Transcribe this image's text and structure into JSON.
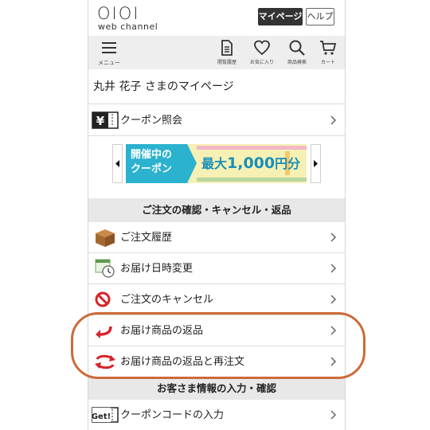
{
  "header": {
    "logo": "OIOI",
    "logo_sub": "web channel",
    "mypage_label": "マイページ",
    "help_label": "ヘルプ"
  },
  "iconbar": {
    "menu_label": "メニュー",
    "tools": [
      {
        "label": "閲覧履歴",
        "icon": "history-icon"
      },
      {
        "label": "お気に入り",
        "icon": "heart-icon"
      },
      {
        "label": "商品検索",
        "icon": "search-icon"
      },
      {
        "label": "カート",
        "icon": "cart-icon"
      }
    ]
  },
  "page": {
    "title": "丸井 花子 さまのマイページ"
  },
  "coupon_row": {
    "label": "クーポン照会",
    "icon_text": "¥"
  },
  "banner": {
    "tag_line1": "開催中の",
    "tag_line2": "クーポン",
    "main_prefix": "最大",
    "main_amount": "1,000",
    "main_suffix": "円分",
    "colors": {
      "teal": "#2ab2cf",
      "yellow": "#f6f0b4"
    }
  },
  "sections": {
    "orders": {
      "title": "ご注文の確認・キャンセル・返品",
      "items": [
        {
          "label": "ご注文履歴",
          "icon": "box-icon"
        },
        {
          "label": "お届け日時変更",
          "icon": "calendar-clock-icon"
        },
        {
          "label": "ご注文のキャンセル",
          "icon": "cancel-icon"
        },
        {
          "label": "お届け商品の返品",
          "icon": "return-arrow-icon"
        },
        {
          "label": "お届け商品の返品と再注文",
          "icon": "reorder-arrows-icon"
        }
      ]
    },
    "customer": {
      "title": "お客さま情報の入力・確認",
      "items": [
        {
          "label": "クーポンコードの入力",
          "icon": "get-coupon-icon",
          "icon_text": "Get!"
        }
      ]
    }
  },
  "highlight_color": "#cd6a3a"
}
